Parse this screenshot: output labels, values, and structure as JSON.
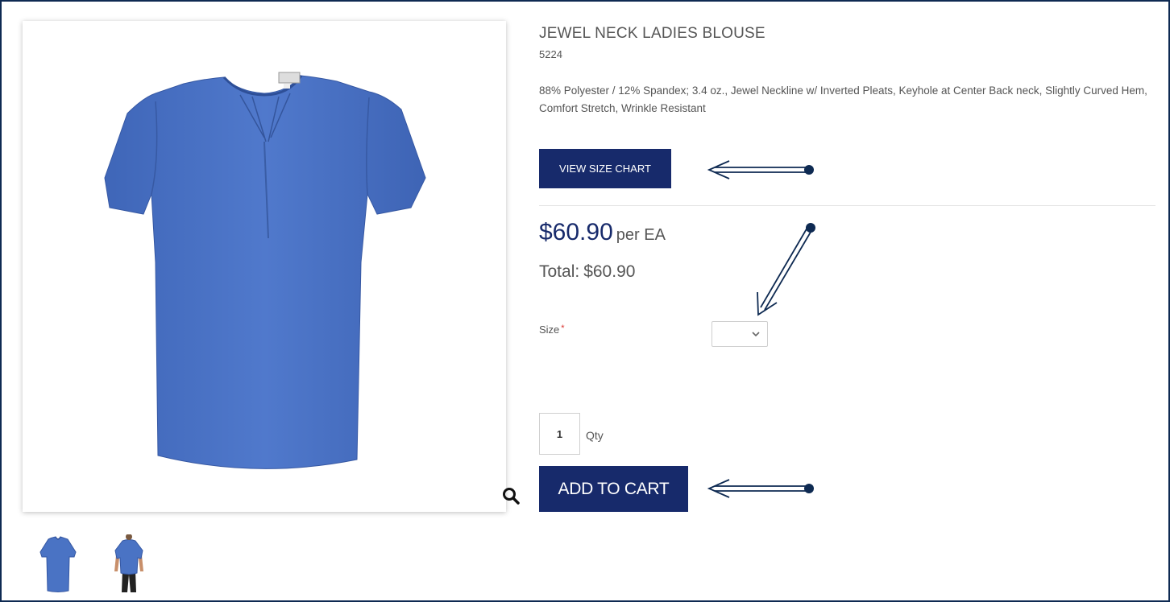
{
  "product": {
    "title": "JEWEL NECK LADIES BLOUSE",
    "sku": "5224",
    "description": "88% Polyester / 12% Spandex; 3.4 oz., Jewel Neckline w/ Inverted Pleats, Keyhole at Center Back neck, Slightly Curved Hem, Comfort Stretch, Wrinkle Resistant",
    "size_chart_label": "VIEW SIZE CHART",
    "price": "$60.90",
    "price_unit": "per EA",
    "total_label": "Total:",
    "total_value": "$60.90",
    "size_label": "Size",
    "required_marker": "*",
    "size_selected": "",
    "qty_value": "1",
    "qty_label": "Qty",
    "add_to_cart_label": "ADD TO CART"
  },
  "gallery": {
    "thumbnails": [
      "blouse-front",
      "blouse-model"
    ],
    "zoom_icon": "magnifier-icon"
  },
  "colors": {
    "brand_navy": "#172a6b",
    "frame_border": "#0e2a52",
    "blouse_blue": "#4a73c4",
    "required_red": "#d9312c"
  }
}
